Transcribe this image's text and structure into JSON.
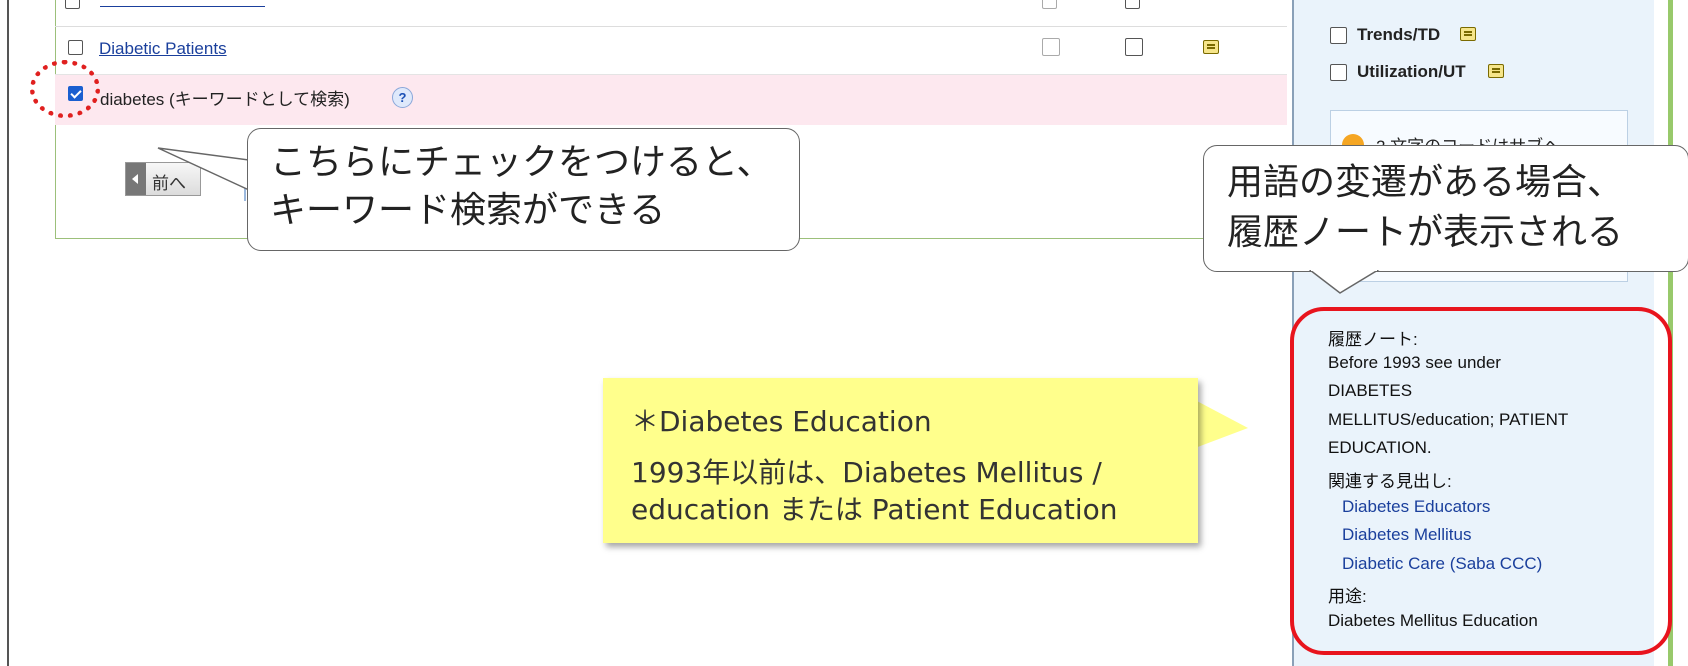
{
  "results": {
    "rows": [
      {
        "label": "Diabetic Patients",
        "type": "link"
      },
      {
        "label": "diabetes (キーワードとして検索)",
        "type": "keyword",
        "checked": true
      }
    ],
    "prev_button": "前へ"
  },
  "callouts": {
    "checkbox_tip": [
      "こちらにチェックをつけると、",
      "キーワード検索ができる"
    ],
    "history_tip": [
      "用語の変遷がある場合、",
      "履歴ノートが表示される"
    ]
  },
  "yellow_note": {
    "heading": "＊Diabetes Education",
    "line1": "1993年以前は、Diabetes Mellitus /",
    "line2": "education または Patient Education"
  },
  "sidebar": {
    "options": [
      {
        "label": "Trends/TD"
      },
      {
        "label": "Utilization/UT"
      }
    ],
    "info_text": "2 文字のコードはサブヘ",
    "history_note_label": "履歴ノート:",
    "history_note_lines": [
      "Before 1993 see under",
      "DIABETES",
      "MELLITUS/education; PATIENT",
      "EDUCATION."
    ],
    "related_label": "関連する見出し:",
    "related_items": [
      "Diabetes Educators",
      "Diabetes Mellitus",
      "Diabetic Care (Saba CCC)"
    ],
    "use_label": "用途:",
    "use_value": "Diabetes Mellitus Education"
  },
  "colors": {
    "link": "#1a3f9c",
    "highlight_row": "#fde8ef",
    "annotation_red": "#e8141d",
    "note_yellow": "#ffff8c",
    "sidebar_bg": "#eaf3fb"
  }
}
